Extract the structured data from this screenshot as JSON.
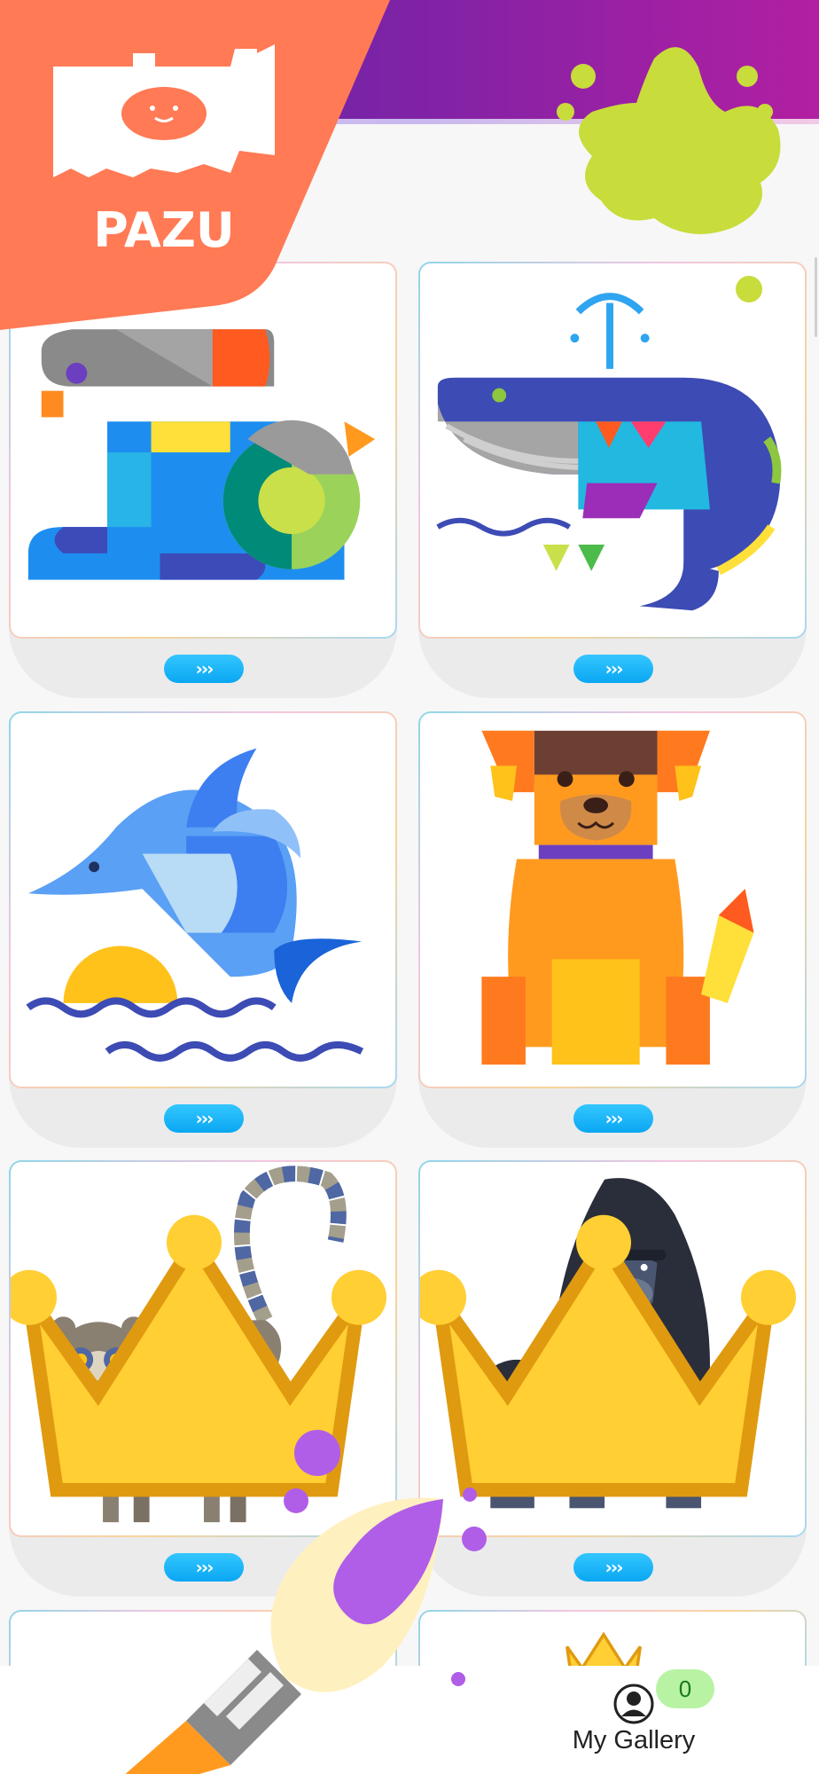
{
  "brand": {
    "name": "PAZU"
  },
  "cards": [
    {
      "animal": "rabbit",
      "next_label": "›››",
      "premium": false
    },
    {
      "animal": "whale",
      "next_label": "›››",
      "premium": false
    },
    {
      "animal": "dolphin",
      "next_label": "›››",
      "premium": false
    },
    {
      "animal": "dog",
      "next_label": "›››",
      "premium": false
    },
    {
      "animal": "lemur",
      "next_label": "›››",
      "premium": true
    },
    {
      "animal": "gorilla",
      "next_label": "›››",
      "premium": true
    },
    {
      "animal": "partial-card",
      "premium": false
    },
    {
      "animal": "partial-card",
      "premium": true
    }
  ],
  "bottom_bar": {
    "gallery_label": "My Gallery",
    "gallery_count": "0"
  },
  "icons": {
    "logo": "pazu-logo-icon",
    "splat": "paint-splat-icon",
    "crown": "crown-icon",
    "brush": "paint-brush-icon",
    "person": "person-icon"
  },
  "colors": {
    "banner": "#7a23a6",
    "logo_bg": "#ff7a55",
    "accent_button": "#18b4f8",
    "splat": "#c8dc3c",
    "paint": "#b05ee8"
  }
}
